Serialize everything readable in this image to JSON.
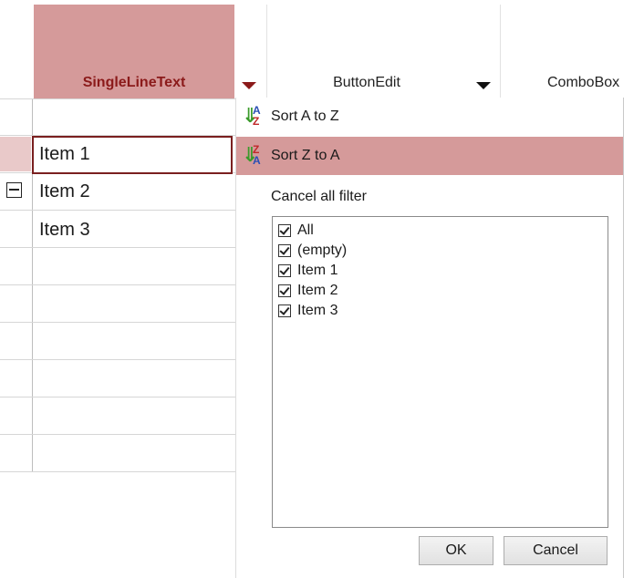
{
  "columns": [
    {
      "label": "SingleLineText",
      "state": "sorted-filter-open"
    },
    {
      "label": "ButtonEdit"
    },
    {
      "label": "ComboBox"
    }
  ],
  "rows": [
    {
      "text": "",
      "state": "new-row"
    },
    {
      "text": "Item 1",
      "state": "selected"
    },
    {
      "text": "Item 2",
      "expander": "collapse-icon"
    },
    {
      "text": "Item 3"
    }
  ],
  "popup": {
    "sort_asc": {
      "label": "Sort A to Z",
      "icon": "sort-ascending-icon"
    },
    "sort_desc": {
      "label": "Sort Z to A",
      "icon": "sort-descending-icon",
      "highlighted": true
    },
    "cancel_filter": "Cancel all filter",
    "filter_items": [
      {
        "label": "All",
        "checked": true
      },
      {
        "label": "(empty)",
        "checked": true
      },
      {
        "label": "Item 1",
        "checked": true
      },
      {
        "label": "Item 2",
        "checked": true
      },
      {
        "label": "Item 3",
        "checked": true
      }
    ],
    "ok_label": "OK",
    "cancel_label": "Cancel"
  },
  "colors": {
    "selected_header": "#d59a9a",
    "selected_header_text": "#8b1a1a",
    "menu_highlight": "#d59a9a",
    "cell_border": "#7a1f1f"
  }
}
